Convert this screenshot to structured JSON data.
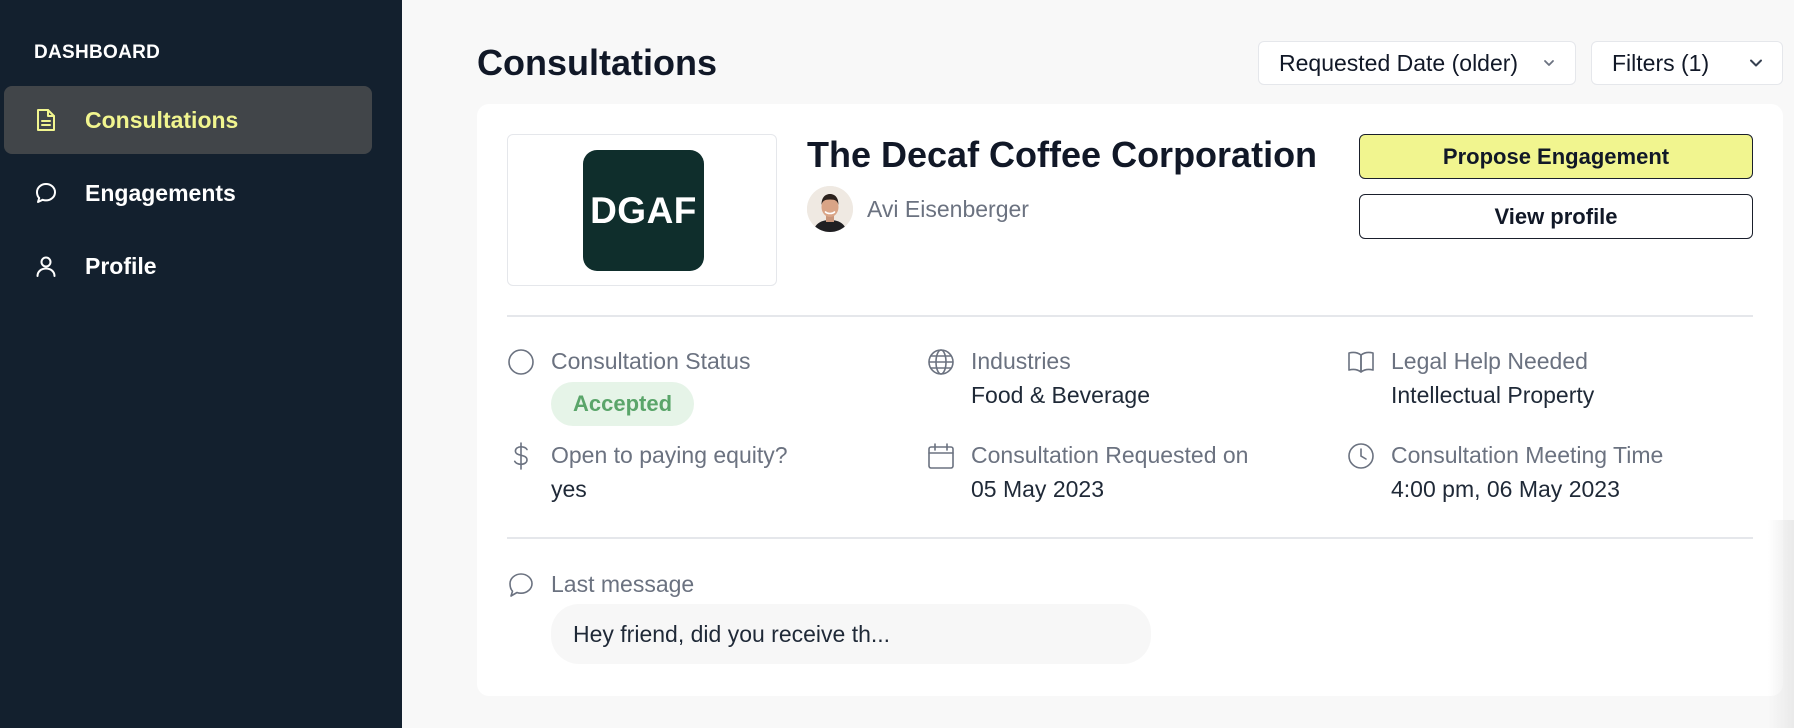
{
  "sidebar": {
    "heading": "DASHBOARD",
    "items": [
      {
        "label": "Consultations",
        "icon": "document-icon",
        "active": true
      },
      {
        "label": "Engagements",
        "icon": "chat-bubble-icon",
        "active": false
      },
      {
        "label": "Profile",
        "icon": "user-icon",
        "active": false
      }
    ]
  },
  "header": {
    "title": "Consultations",
    "sort_label": "Requested Date (older)",
    "filter_label": "Filters (1)"
  },
  "consultation": {
    "logo_text": "DGAF",
    "company_name": "The Decaf Coffee Corporation",
    "contact_name": "Avi Eisenberger",
    "primary_action": "Propose Engagement",
    "secondary_action": "View profile",
    "fields": {
      "status": {
        "label": "Consultation Status",
        "value": "Accepted"
      },
      "industries": {
        "label": "Industries",
        "value": "Food & Beverage"
      },
      "legal_help": {
        "label": "Legal Help Needed",
        "value": "Intellectual Property"
      },
      "equity": {
        "label": "Open to paying equity?",
        "value": "yes"
      },
      "requested_on": {
        "label": "Consultation Requested on",
        "value": "05 May 2023"
      },
      "meeting_time": {
        "label": "Consultation Meeting Time",
        "value": "4:00 pm, 06 May 2023"
      }
    },
    "last_message": {
      "label": "Last message",
      "text": "Hey friend, did you receive th..."
    }
  },
  "colors": {
    "sidebar_bg": "#13202e",
    "accent": "#f1f58f",
    "status_bg": "#e6f4e8",
    "status_text": "#5aa56a",
    "logo_bg": "#0f2e2c"
  }
}
